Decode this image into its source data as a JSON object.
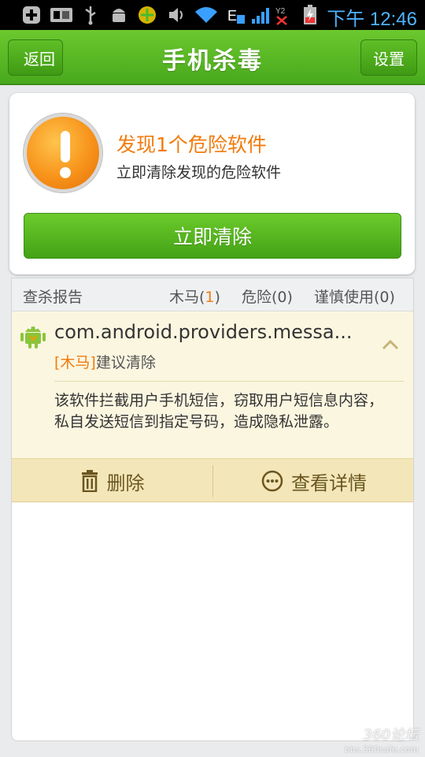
{
  "status_bar": {
    "time": "下午 12:46"
  },
  "title_bar": {
    "title": "手机杀毒",
    "back_label": "返回",
    "settings_label": "设置"
  },
  "alert": {
    "title": "发现1个危险软件",
    "subtitle": "立即清除发现的危险软件",
    "action_label": "立即清除"
  },
  "report": {
    "header_label": "查杀报告",
    "stats": [
      {
        "label": "木马(",
        "count": "1",
        "suffix": ")"
      },
      {
        "label": "危险(0)"
      },
      {
        "label": "谨慎使用(0)"
      }
    ],
    "items": [
      {
        "package": "com.android.providers.messa...",
        "tag": "[木马]",
        "advice": "建议清除",
        "description": "该软件拦截用户手机短信，窃取用户短信息内容，私自发送短信到指定号码，造成隐私泄露。",
        "delete_label": "删除",
        "detail_label": "查看详情"
      }
    ]
  },
  "watermark": {
    "logo": "360论坛",
    "url": "bbs.360safe.com"
  },
  "colors": {
    "accent_green": "#48a91d",
    "warning_orange": "#f07c0e",
    "item_bg": "#fbf6e0"
  }
}
